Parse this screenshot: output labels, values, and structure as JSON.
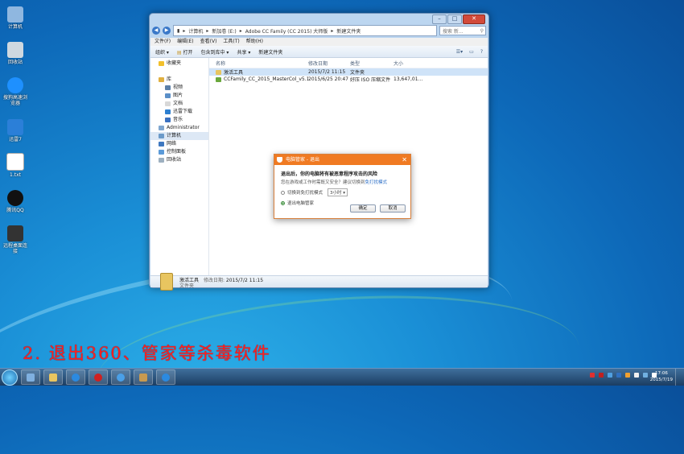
{
  "desktop": {
    "icons": [
      {
        "label": "计算机",
        "icon": "computer-icon",
        "color": "#8fb7e0"
      },
      {
        "label": "回收站",
        "icon": "recycle-bin-icon",
        "color": "#cfd8e0"
      },
      {
        "label": "搜狗高速浏览器",
        "icon": "sogou-browser-icon",
        "color": "#1e90ff"
      },
      {
        "label": "迅雷7",
        "icon": "thunder-icon",
        "color": "#2b7fd8"
      },
      {
        "label": "1.txt",
        "icon": "text-file-icon",
        "color": "#ffffff"
      },
      {
        "label": "腾讯QQ",
        "icon": "qq-icon",
        "color": "#111111"
      },
      {
        "label": "远程桌面连接",
        "icon": "remote-desktop-icon",
        "color": "#333333"
      }
    ]
  },
  "window": {
    "controls": {
      "minimize": "–",
      "maximize": "□",
      "close": "✕"
    },
    "address": {
      "segments": [
        "计算机",
        "新加卷 (E:)",
        "Adobe CC Family (CC 2015) 大师版",
        "新建文件夹"
      ],
      "separator": "▸"
    },
    "search_placeholder": "搜索 新...",
    "menu": [
      "文件(F)",
      "编辑(E)",
      "查看(V)",
      "工具(T)",
      "帮助(H)"
    ],
    "toolbar": [
      {
        "label": "组织 ▾",
        "icon": ""
      },
      {
        "label": "打开",
        "icon": "open-icon"
      },
      {
        "label": "包含到库中 ▾",
        "icon": ""
      },
      {
        "label": "共享 ▾",
        "icon": ""
      },
      {
        "label": "新建文件夹",
        "icon": ""
      }
    ],
    "nav": [
      {
        "label": "收藏夹",
        "icon": "star-icon",
        "indent": 1,
        "color": "#f2c02c"
      },
      {
        "label": "",
        "icon": "",
        "indent": 0,
        "color": ""
      },
      {
        "label": "库",
        "icon": "library-icon",
        "indent": 1,
        "color": "#e0b040"
      },
      {
        "label": "视频",
        "icon": "video-icon",
        "indent": 2,
        "color": "#5a7fa8"
      },
      {
        "label": "图片",
        "icon": "picture-icon",
        "indent": 2,
        "color": "#5a8fc8"
      },
      {
        "label": "文档",
        "icon": "document-icon",
        "indent": 2,
        "color": "#d8d8d8"
      },
      {
        "label": "迅雷下载",
        "icon": "thunder-download-icon",
        "indent": 2,
        "color": "#2d7fd0"
      },
      {
        "label": "音乐",
        "icon": "music-icon",
        "indent": 2,
        "color": "#3a70c0"
      },
      {
        "label": "Administrator",
        "icon": "user-icon",
        "indent": 1,
        "color": "#7fa6d0"
      },
      {
        "label": "计算机",
        "icon": "computer-icon",
        "indent": 1,
        "color": "#6b9ac9",
        "selected": true
      },
      {
        "label": "网络",
        "icon": "network-icon",
        "indent": 1,
        "color": "#3f78c0"
      },
      {
        "label": "控制面板",
        "icon": "control-panel-icon",
        "indent": 1,
        "color": "#5a9ad8"
      },
      {
        "label": "回收站",
        "icon": "recycle-bin-icon",
        "indent": 1,
        "color": "#9db0c0"
      }
    ],
    "columns": {
      "name": "名称",
      "date": "修改日期",
      "type": "类型",
      "size": "大小"
    },
    "files": [
      {
        "name": "激活工具",
        "date": "2015/7/2 11:15",
        "type": "文件夹",
        "size": "",
        "icon": "folder-icon",
        "color": "#e8c560",
        "selected": true
      },
      {
        "name": "CCFamily_CC_2015_MasterCol_v5.11....",
        "date": "2015/6/25 20:47",
        "type": "好压 ISO 压缩文件",
        "size": "13,647,01...",
        "icon": "iso-file-icon",
        "color": "#6aa83c",
        "selected": false
      }
    ],
    "details": {
      "name": "激活工具",
      "modified_label": "修改日期:",
      "modified": "2015/7/2 11:15",
      "type": "文件夹"
    }
  },
  "dialog": {
    "title": "电脑管家 - 退出",
    "close": "✕",
    "message": "退出后，你的电脑将有被恶意程序攻击的风险",
    "sub_prefix": "您在游戏或工作时需既又安全？建议切换到",
    "sub_link": "免打扰模式",
    "option1": "切换到免打扰模式",
    "option1_value": "3小时",
    "option2": "退出电脑管家",
    "confirm": "确定",
    "cancel": "取消"
  },
  "caption": "2. 退出360、管家等杀毒软件",
  "taskbar": {
    "apps": [
      {
        "name": "control-panel",
        "color": "#7fb0e0"
      },
      {
        "name": "explorer",
        "color": "#e8c560"
      },
      {
        "name": "sogou",
        "color": "#2b8ae0"
      },
      {
        "name": "recorder",
        "color": "#d02020"
      },
      {
        "name": "ie",
        "color": "#4aa0e8"
      },
      {
        "name": "photoshop-like",
        "color": "#c89a50"
      },
      {
        "name": "sogou-2",
        "color": "#2b8ae0"
      }
    ],
    "tray": [
      "#e03030",
      "#c02020",
      "#50a0e0",
      "#3070c0",
      "#f0a030",
      "#f0f0f0",
      "#70b0e0",
      "#ffffff"
    ],
    "time": "17:06",
    "date": "2015/7/19"
  }
}
